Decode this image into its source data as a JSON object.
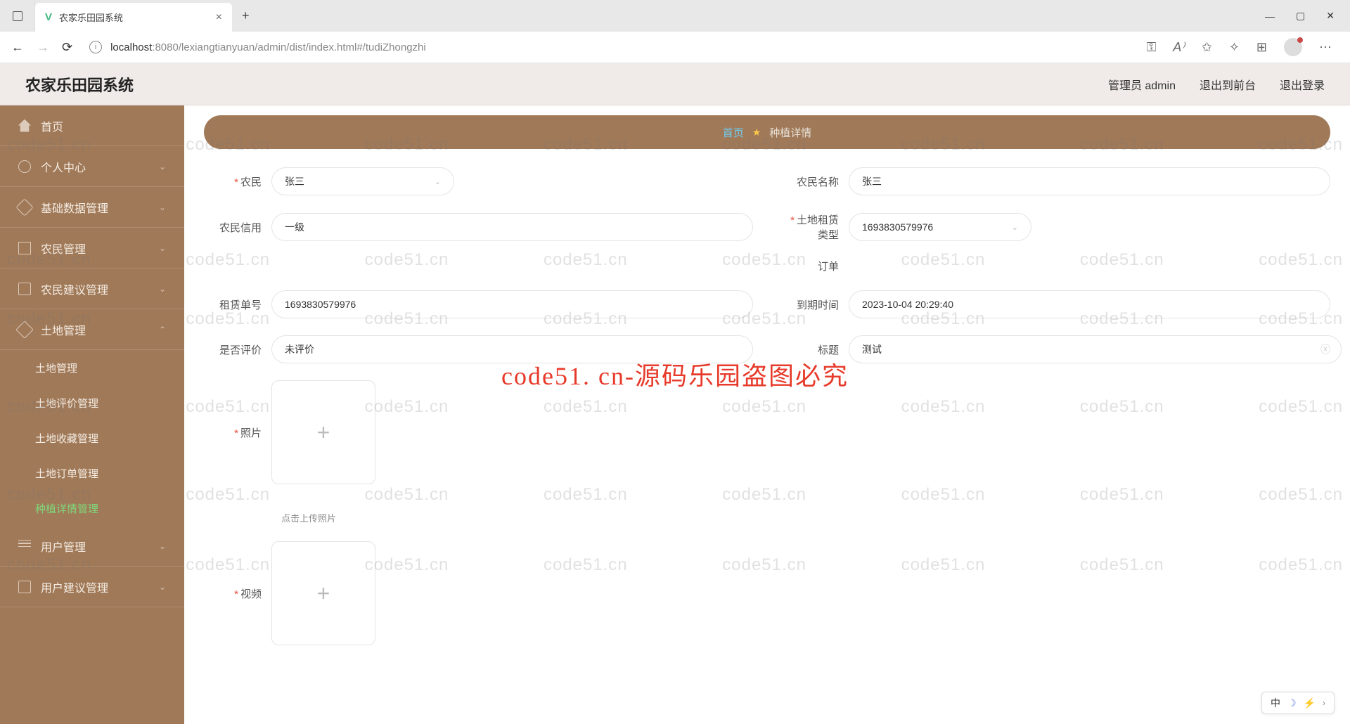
{
  "browser": {
    "tab_title": "农家乐田园系统",
    "url_host": "localhost",
    "url_port": ":8080",
    "url_path": "/lexiangtianyuan/admin/dist/index.html#/tudiZhongzhi"
  },
  "header": {
    "app_title": "农家乐田园系统",
    "user_label": "管理员 admin",
    "to_front": "退出到前台",
    "logout": "退出登录"
  },
  "sidebar": {
    "home": "首页",
    "personal": "个人中心",
    "basic_data": "基础数据管理",
    "farmer_mgmt": "农民管理",
    "farmer_advice": "农民建议管理",
    "land_mgmt": "土地管理",
    "land_sub": {
      "land": "土地管理",
      "land_review": "土地评价管理",
      "land_collect": "土地收藏管理",
      "land_order": "土地订单管理",
      "plant_detail": "种植详情管理"
    },
    "user_mgmt": "用户管理",
    "user_advice": "用户建议管理"
  },
  "breadcrumb": {
    "home": "首页",
    "current": "种植详情"
  },
  "form": {
    "farmer_label": "农民",
    "farmer_value": "张三",
    "farmer_name_label": "农民名称",
    "farmer_name_value": "张三",
    "credit_label": "农民信用",
    "credit_value": "一级",
    "lease_type_label": "土地租赁类型",
    "lease_type_value": "1693830579976",
    "order_label": "订单",
    "lease_no_label": "租赁单号",
    "lease_no_value": "1693830579976",
    "expire_label": "到期时间",
    "expire_value": "2023-10-04 20:29:40",
    "evaluated_label": "是否评价",
    "evaluated_value": "未评价",
    "title_label": "标题",
    "title_value": "测试",
    "photo_label": "照片",
    "photo_hint": "点击上传照片",
    "video_label": "视频"
  },
  "watermark": {
    "small": "code51.cn",
    "big": "code51. cn-源码乐园盗图必究"
  },
  "float": {
    "lang": "中"
  }
}
